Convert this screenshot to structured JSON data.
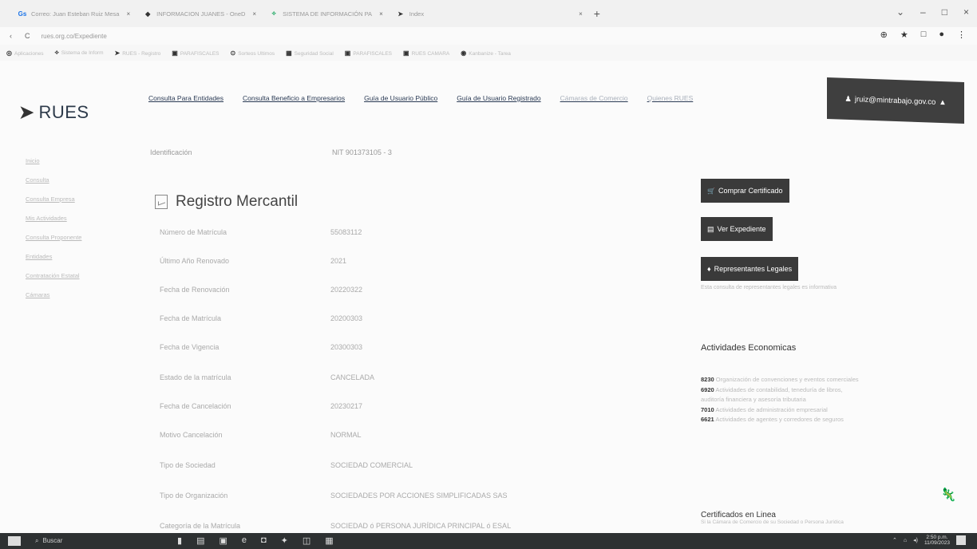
{
  "tabs": [
    {
      "icon": "Gs",
      "label": "Correo: Juan Esteban Ruiz Mesa",
      "close": "×"
    },
    {
      "icon": "◆",
      "label": "INFORMACION JUANES - OneD",
      "close": "×"
    },
    {
      "icon": "⟡",
      "label": "SISTEMA DE INFORMACIÓN PA",
      "close": "×"
    },
    {
      "icon": "➤",
      "label": "Index",
      "close": "×"
    }
  ],
  "new_tab": "+",
  "window_controls": [
    "⌄",
    "–",
    "□",
    "×"
  ],
  "address": {
    "back": "‹",
    "reload": "C",
    "url": "rues.org.co/Expediente"
  },
  "address_actions": [
    "⊕",
    "★",
    "□",
    "●",
    "⋮"
  ],
  "bookmarks": [
    "Aplicaciones",
    "Sistema de Inform",
    "RUES - Registro",
    "PARAFISCALES",
    "Sorteos Ultimos",
    "Seguridad Social",
    "PARAFISCALES",
    "RUES CAMARA",
    "Kanbanize - Tarea"
  ],
  "brand": {
    "logo_mark": "➤",
    "name": "RUES"
  },
  "nav": [
    {
      "label": "Consulta Para Entidades",
      "faint": false
    },
    {
      "label": "Consulta Beneficio a Empresarios",
      "faint": false
    },
    {
      "label": "Guía de Usuario Público",
      "faint": false
    },
    {
      "label": "Guía de Usuario Registrado",
      "faint": false
    },
    {
      "label": "Cámaras de Comercio",
      "faint": true
    },
    {
      "label": "Quienes RUES",
      "faint": true
    }
  ],
  "user": {
    "icon": "♟",
    "email": "jruiz@mintrabajo.gov.co",
    "caret": "▲"
  },
  "sidebar": [
    "Inicio",
    "Consulta",
    "Consulta Empresa",
    "Mis Actividades",
    "Consulta Proponente",
    "Entidades",
    "Contratación Estatal",
    "Cámaras"
  ],
  "prev_row": {
    "label": "Identificación",
    "value": "NIT 901373105 - 3"
  },
  "title": "Registro Mercantil",
  "fields": [
    {
      "label": "Número de Matrícula",
      "value": "55083112"
    },
    {
      "label": "Último Año Renovado",
      "value": "2021"
    },
    {
      "label": "Fecha de Renovación",
      "value": "20220322"
    },
    {
      "label": "Fecha de Matrícula",
      "value": "20200303"
    },
    {
      "label": "Fecha de Vigencia",
      "value": "20300303"
    },
    {
      "label": "Estado de la matrícula",
      "value": "CANCELADA"
    },
    {
      "label": "Fecha de Cancelación",
      "value": "20230217"
    },
    {
      "label": "Motivo Cancelación",
      "value": "NORMAL"
    },
    {
      "label": "Tipo de Sociedad",
      "value": "SOCIEDAD COMERCIAL"
    },
    {
      "label": "Tipo de Organización",
      "value": "SOCIEDADES POR ACCIONES SIMPLIFICADAS SAS"
    },
    {
      "label": "Categoría de la Matrícula",
      "value": "SOCIEDAD ó PERSONA JURÍDICA PRINCIPAL ó ESAL"
    }
  ],
  "actions": [
    {
      "icon": "🛒",
      "label": "Comprar Certificado"
    },
    {
      "icon": "▤",
      "label": "Ver Expediente"
    },
    {
      "icon": "♦",
      "label": "Representantes Legales"
    }
  ],
  "actions_note": "Esta consulta de representantes legales es informativa",
  "activities_title": "Actividades Economicas",
  "activities": [
    {
      "code": "8230",
      "text": "Organización de convenciones y eventos comerciales"
    },
    {
      "code": "6920",
      "text": "Actividades de contabilidad, teneduría de libros, auditoría financiera y asesoría tributaria"
    },
    {
      "code": "7010",
      "text": "Actividades de administración empresarial"
    },
    {
      "code": "6621",
      "text": "Actividades de agentes y corredores de seguros"
    }
  ],
  "cert_title": "Certificados en Linea",
  "cert_sub": "Si la Cámara de Comercio de su Sociedad o Persona Jurídica",
  "taskbar": {
    "search": "Buscar",
    "time": "2:50 p.m.",
    "date": "11/09/2023"
  }
}
